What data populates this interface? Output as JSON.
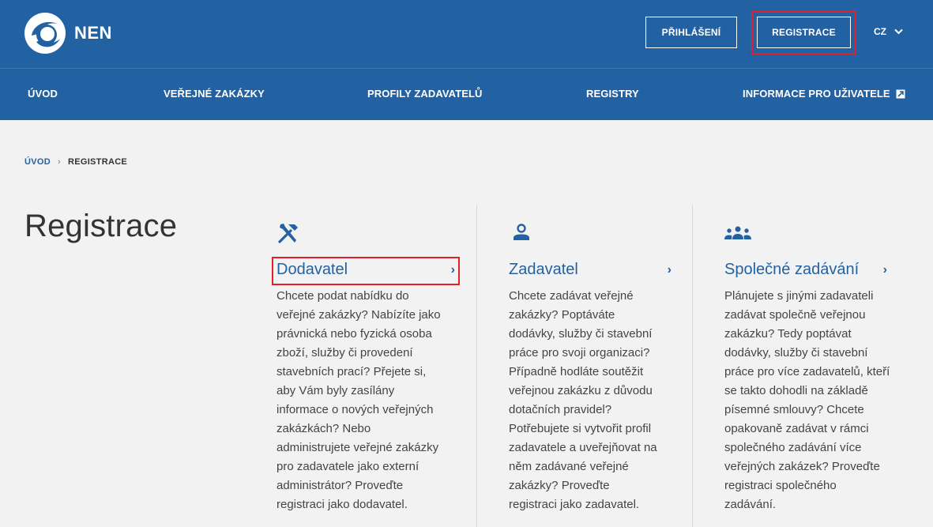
{
  "header": {
    "logo_text": "NEN",
    "login_label": "PŘIHLÁŠENÍ",
    "register_label": "REGISTRACE",
    "language": "CZ"
  },
  "nav": {
    "items": [
      {
        "label": "ÚVOD"
      },
      {
        "label": "VEŘEJNÉ ZAKÁZKY"
      },
      {
        "label": "PROFILY ZADAVATELŮ"
      },
      {
        "label": "REGISTRY"
      },
      {
        "label": "INFORMACE PRO UŽIVATELE"
      }
    ]
  },
  "breadcrumb": {
    "home": "ÚVOD",
    "separator": "›",
    "current": "REGISTRACE"
  },
  "page_title": "Registrace",
  "cards": [
    {
      "icon": "tools-icon",
      "title": "Dodavatel",
      "chevron": "›",
      "lines": [
        "Chcete podat nabídku do",
        "veřejné zakázky? Nabízíte jako",
        "právnická nebo fyzická osoba",
        "zboží, služby či provedení",
        "stavebních prací? Přejete si,",
        "aby Vám byly zasílány",
        "informace o nových veřejných",
        "zakázkách? Nebo",
        "administrujete veřejné zakázky",
        "pro zadavatele jako externí",
        "administrátor? Proveďte",
        "registraci jako dodavatel."
      ]
    },
    {
      "icon": "person-icon",
      "title": "Zadavatel",
      "chevron": "›",
      "lines": [
        "Chcete zadávat veřejné",
        "zakázky? Poptáváte",
        "dodávky, služby či stavební",
        "práce pro svoji organizaci?",
        "Případně hodláte soutěžit",
        "veřejnou zakázku z důvodu",
        "dotačních pravidel?",
        "Potřebujete si vytvořit profil",
        "zadavatele a uveřejňovat na",
        "něm zadávané veřejné",
        "zakázky? Proveďte",
        "registraci jako zadavatel."
      ]
    },
    {
      "icon": "group-icon",
      "title": "Společné zadávání",
      "chevron": "›",
      "lines": [
        "Plánujete s jinými zadavateli",
        "zadávat společně veřejnou",
        "zakázku? Tedy poptávat",
        "dodávky, služby či stavební",
        "práce pro více zadavatelů, kteří",
        "se takto dohodli na základě",
        "písemné smlouvy? Chcete",
        "opakovaně zadávat v rámci",
        "společného zadávání více",
        "veřejných zakázek? Proveďte",
        "registraci společného",
        "zadávání."
      ]
    }
  ]
}
